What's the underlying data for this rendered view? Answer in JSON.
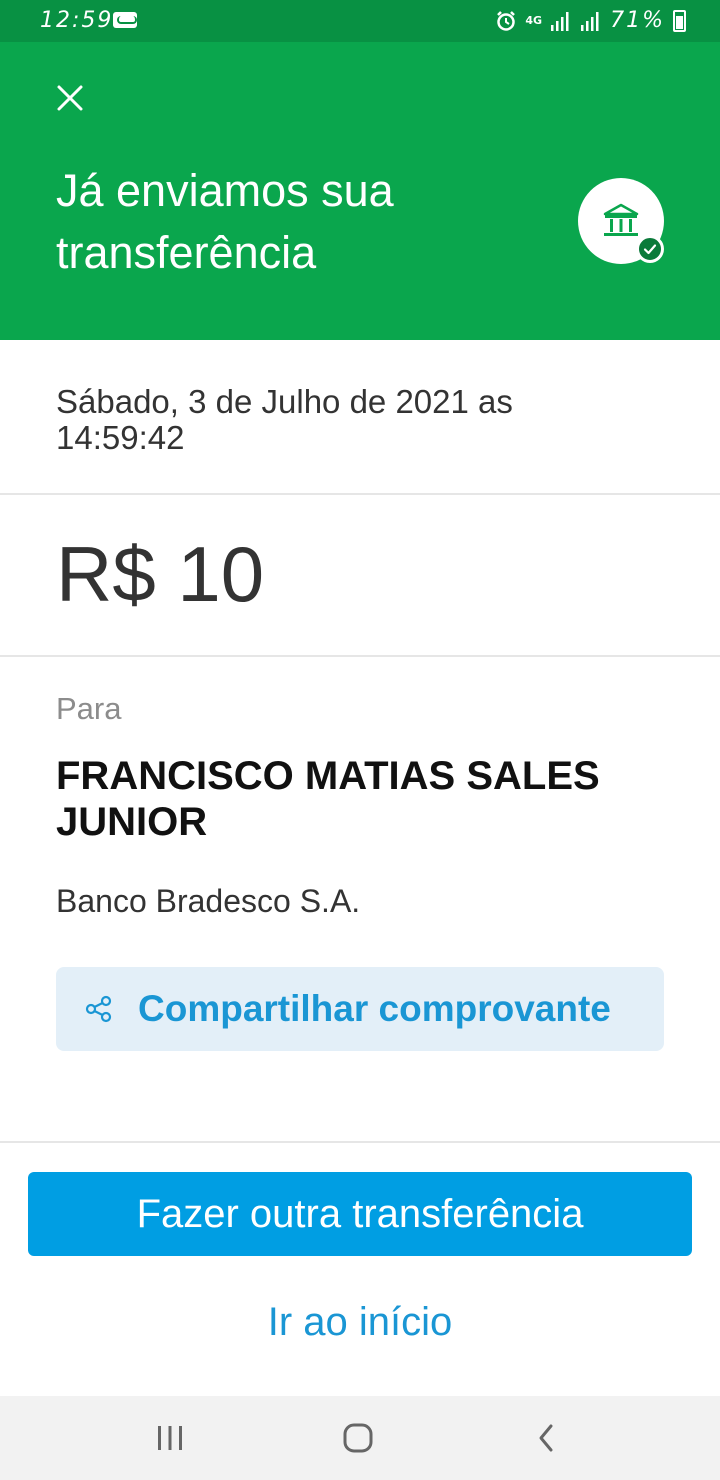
{
  "status_bar": {
    "time": "12:59",
    "network": "4G",
    "battery": "71%"
  },
  "header": {
    "title": "Já enviamos sua transferência"
  },
  "transfer": {
    "datetime": "Sábado, 3 de Julho de 2021 as 14:59:42",
    "amount": "R$ 10",
    "to_label": "Para",
    "recipient_name": "FRANCISCO MATIAS SALES JUNIOR",
    "bank": "Banco Bradesco S.A."
  },
  "actions": {
    "share_label": "Compartilhar comprovante",
    "primary_label": "Fazer outra transferência",
    "home_label": "Ir ao início"
  },
  "colors": {
    "header_green": "#0aa64d",
    "status_green": "#089143",
    "primary_blue": "#009ee3",
    "link_blue": "#1a96d4"
  },
  "icons": {
    "close": "close-icon",
    "bank": "bank-icon",
    "check": "check-icon",
    "share": "share-icon",
    "recents": "recent-apps-icon",
    "home": "home-icon",
    "back": "back-icon"
  }
}
